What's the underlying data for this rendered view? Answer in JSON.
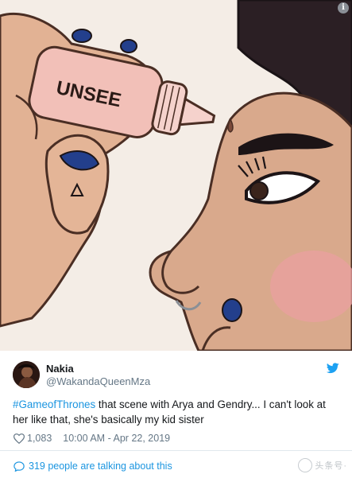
{
  "media": {
    "bottle_label": "UNSEE",
    "info_badge": "i"
  },
  "tweet": {
    "display_name": "Nakia",
    "handle": "@WakandaQueenMza",
    "hashtag": "#GameofThrones",
    "text_rest": " that scene with Arya and Gendry... I can't look at her like that, she's basically my kid sister",
    "likes": "1,083",
    "timestamp": "10:00 AM - Apr 22, 2019",
    "conversation": "319 people are talking about this"
  },
  "watermark": {
    "text": "头条号·"
  },
  "colors": {
    "link_blue": "#1b95e0",
    "text": "#14171a",
    "muted": "#657786"
  },
  "icons": [
    "info-icon",
    "twitter-bird-icon",
    "heart-icon",
    "speech-bubble-icon"
  ]
}
